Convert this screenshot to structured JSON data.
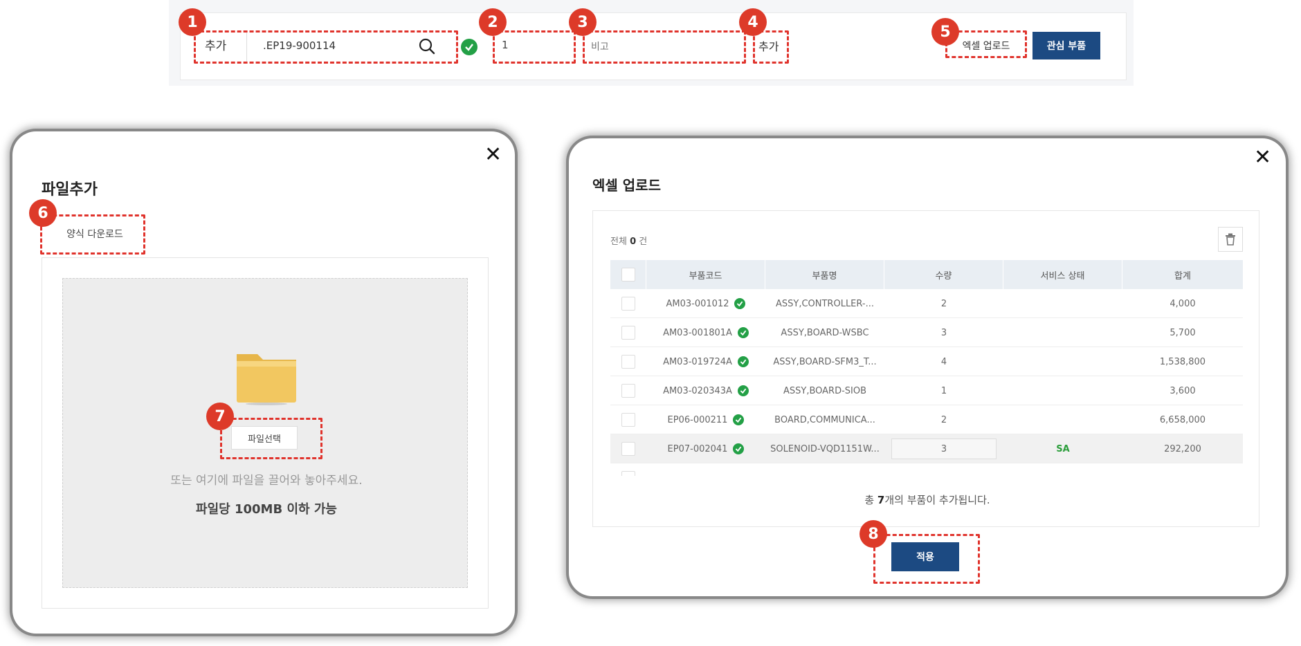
{
  "topbar": {
    "add_label": "추가",
    "part_code_value": ".EP19-900114",
    "quantity_value": "1",
    "note_placeholder": "비고",
    "add_button": "추가",
    "excel_upload_button": "엑셀 업로드",
    "interest_parts_button": "관심 부품"
  },
  "badges": [
    "1",
    "2",
    "3",
    "4",
    "5",
    "6",
    "7",
    "8"
  ],
  "file_modal": {
    "title": "파일추가",
    "template_download": "양식 다운로드",
    "file_select": "파일선택",
    "drop_hint": "또는 여기에 파일을 끌어와 놓아주세요.",
    "size_limit": "파일당 100MB 이하 가능"
  },
  "excel_modal": {
    "title": "엑셀 업로드",
    "total_prefix": "전체",
    "total_count": "0",
    "total_suffix": "건",
    "columns": [
      "부품코드",
      "부품명",
      "수량",
      "서비스 상태",
      "합계"
    ],
    "rows": [
      {
        "code": "AM03-001012",
        "name": "ASSY,CONTROLLER-...",
        "qty": "2",
        "status": "",
        "total": "4,000"
      },
      {
        "code": "AM03-001801A",
        "name": "ASSY,BOARD-WSBC",
        "qty": "3",
        "status": "",
        "total": "5,700"
      },
      {
        "code": "AM03-019724A",
        "name": "ASSY,BOARD-SFM3_T...",
        "qty": "4",
        "status": "",
        "total": "1,538,800"
      },
      {
        "code": "AM03-020343A",
        "name": "ASSY,BOARD-SIOB",
        "qty": "1",
        "status": "",
        "total": "3,600"
      },
      {
        "code": "EP06-000211",
        "name": "BOARD,COMMUNICA...",
        "qty": "2",
        "status": "",
        "total": "6,658,000"
      },
      {
        "code": "EP07-002041",
        "name": "SOLENOID-VQD1151W...",
        "qty": "3",
        "status": "SA",
        "total": "292,200"
      }
    ],
    "summary_prefix": "총",
    "summary_count": "7",
    "summary_suffix": "개의 부품이 추가됩니다.",
    "apply_button": "적용"
  },
  "colors": {
    "primary": "#1c4a82",
    "annotation_red": "#dd3a29",
    "check_green": "#23a046"
  }
}
